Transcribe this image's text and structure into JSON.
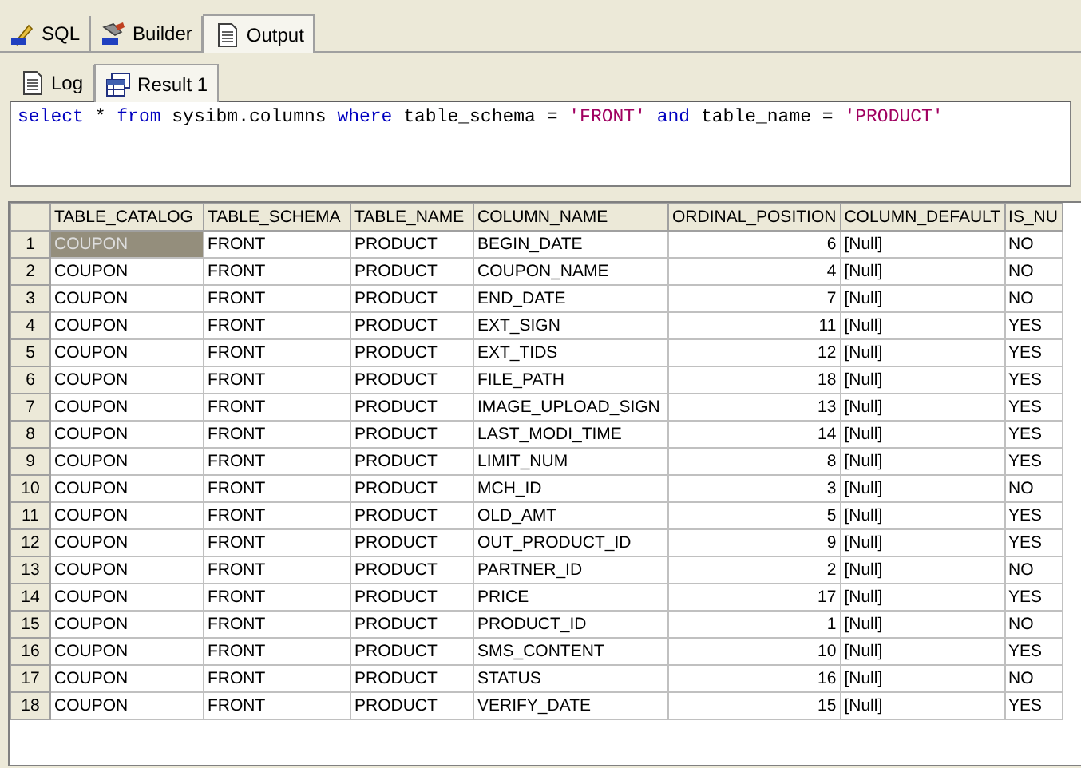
{
  "tabs": [
    {
      "label": "SQL",
      "selected": false
    },
    {
      "label": "Builder",
      "selected": false
    },
    {
      "label": "Output",
      "selected": true
    }
  ],
  "subtabs": [
    {
      "label": "Log",
      "selected": false
    },
    {
      "label": "Result 1",
      "selected": true
    }
  ],
  "query": [
    {
      "kind": "keyword",
      "text": "select"
    },
    {
      "kind": "text",
      "text": "*"
    },
    {
      "kind": "keyword",
      "text": "from"
    },
    {
      "kind": "text",
      "text": "sysibm.columns"
    },
    {
      "kind": "keyword",
      "text": "where"
    },
    {
      "kind": "text",
      "text": "table_schema ="
    },
    {
      "kind": "string",
      "text": "'FRONT'"
    },
    {
      "kind": "keyword",
      "text": "and"
    },
    {
      "kind": "text",
      "text": "table_name ="
    },
    {
      "kind": "string",
      "text": "'PRODUCT'"
    }
  ],
  "table": {
    "columns": [
      {
        "label": "TABLE_CATALOG",
        "kind": "text"
      },
      {
        "label": "TABLE_SCHEMA",
        "kind": "text"
      },
      {
        "label": "TABLE_NAME",
        "kind": "text"
      },
      {
        "label": "COLUMN_NAME",
        "kind": "text"
      },
      {
        "label": "ORDINAL_POSITION",
        "kind": "number"
      },
      {
        "label": "COLUMN_DEFAULT",
        "kind": "text"
      },
      {
        "label": "IS_NU",
        "kind": "text"
      }
    ],
    "rows": [
      {
        "number": "1",
        "selected": true,
        "cells": [
          "COUPON",
          "FRONT",
          "PRODUCT",
          "BEGIN_DATE",
          "6",
          "[Null]",
          "NO"
        ]
      },
      {
        "number": "2",
        "selected": false,
        "cells": [
          "COUPON",
          "FRONT",
          "PRODUCT",
          "COUPON_NAME",
          "4",
          "[Null]",
          "NO"
        ]
      },
      {
        "number": "3",
        "selected": false,
        "cells": [
          "COUPON",
          "FRONT",
          "PRODUCT",
          "END_DATE",
          "7",
          "[Null]",
          "NO"
        ]
      },
      {
        "number": "4",
        "selected": false,
        "cells": [
          "COUPON",
          "FRONT",
          "PRODUCT",
          "EXT_SIGN",
          "11",
          "[Null]",
          "YES"
        ]
      },
      {
        "number": "5",
        "selected": false,
        "cells": [
          "COUPON",
          "FRONT",
          "PRODUCT",
          "EXT_TIDS",
          "12",
          "[Null]",
          "YES"
        ]
      },
      {
        "number": "6",
        "selected": false,
        "cells": [
          "COUPON",
          "FRONT",
          "PRODUCT",
          "FILE_PATH",
          "18",
          "[Null]",
          "YES"
        ]
      },
      {
        "number": "7",
        "selected": false,
        "cells": [
          "COUPON",
          "FRONT",
          "PRODUCT",
          "IMAGE_UPLOAD_SIGN",
          "13",
          "[Null]",
          "YES"
        ]
      },
      {
        "number": "8",
        "selected": false,
        "cells": [
          "COUPON",
          "FRONT",
          "PRODUCT",
          "LAST_MODI_TIME",
          "14",
          "[Null]",
          "YES"
        ]
      },
      {
        "number": "9",
        "selected": false,
        "cells": [
          "COUPON",
          "FRONT",
          "PRODUCT",
          "LIMIT_NUM",
          "8",
          "[Null]",
          "YES"
        ]
      },
      {
        "number": "10",
        "selected": false,
        "cells": [
          "COUPON",
          "FRONT",
          "PRODUCT",
          "MCH_ID",
          "3",
          "[Null]",
          "NO"
        ]
      },
      {
        "number": "11",
        "selected": false,
        "cells": [
          "COUPON",
          "FRONT",
          "PRODUCT",
          "OLD_AMT",
          "5",
          "[Null]",
          "YES"
        ]
      },
      {
        "number": "12",
        "selected": false,
        "cells": [
          "COUPON",
          "FRONT",
          "PRODUCT",
          "OUT_PRODUCT_ID",
          "9",
          "[Null]",
          "YES"
        ]
      },
      {
        "number": "13",
        "selected": false,
        "cells": [
          "COUPON",
          "FRONT",
          "PRODUCT",
          "PARTNER_ID",
          "2",
          "[Null]",
          "NO"
        ]
      },
      {
        "number": "14",
        "selected": false,
        "cells": [
          "COUPON",
          "FRONT",
          "PRODUCT",
          "PRICE",
          "17",
          "[Null]",
          "YES"
        ]
      },
      {
        "number": "15",
        "selected": false,
        "cells": [
          "COUPON",
          "FRONT",
          "PRODUCT",
          "PRODUCT_ID",
          "1",
          "[Null]",
          "NO"
        ]
      },
      {
        "number": "16",
        "selected": false,
        "cells": [
          "COUPON",
          "FRONT",
          "PRODUCT",
          "SMS_CONTENT",
          "10",
          "[Null]",
          "YES"
        ]
      },
      {
        "number": "17",
        "selected": false,
        "cells": [
          "COUPON",
          "FRONT",
          "PRODUCT",
          "STATUS",
          "16",
          "[Null]",
          "NO"
        ]
      },
      {
        "number": "18",
        "selected": false,
        "cells": [
          "COUPON",
          "FRONT",
          "PRODUCT",
          "VERIFY_DATE",
          "15",
          "[Null]",
          "YES"
        ]
      }
    ]
  }
}
